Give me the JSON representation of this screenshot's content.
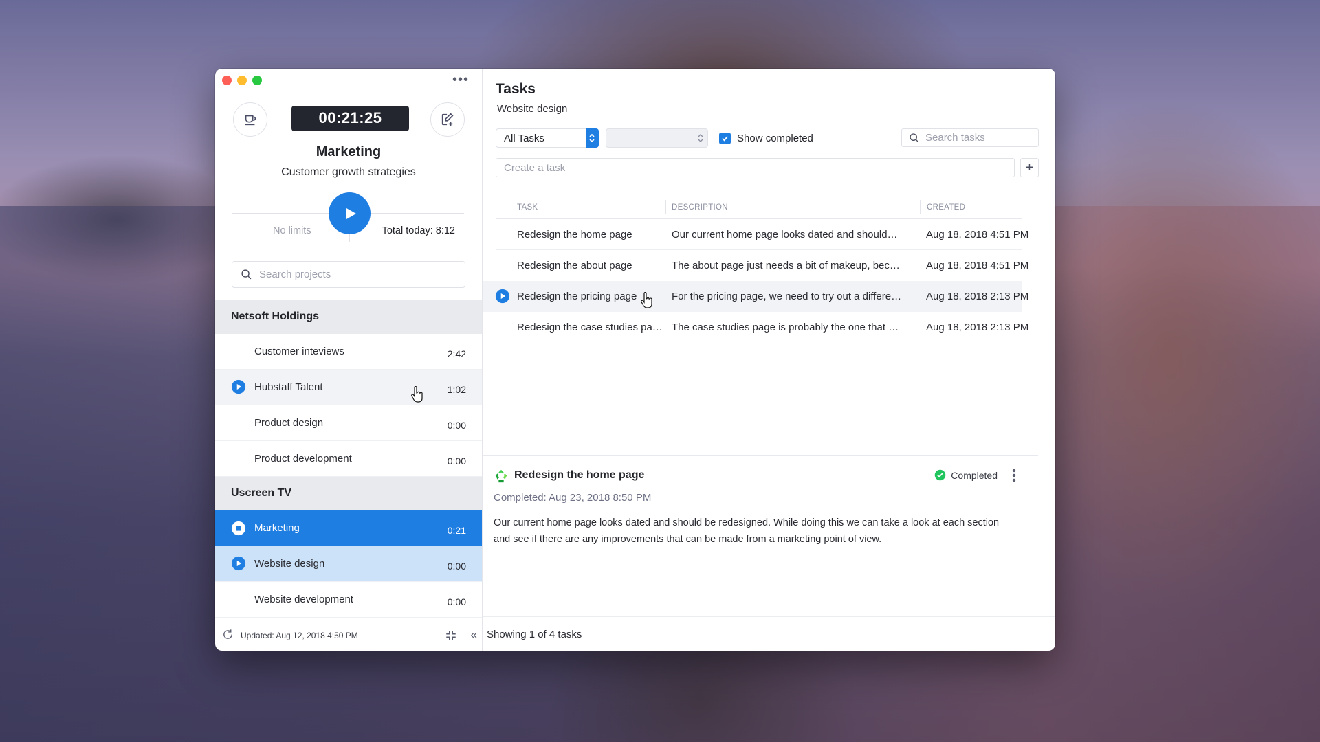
{
  "window": {
    "controls": [
      "close",
      "minimize",
      "zoom"
    ],
    "more_menu_icon": "ellipsis-icon"
  },
  "sidebar": {
    "break_button_icon": "coffee-cup-icon",
    "timer": "00:21:25",
    "edit_button_icon": "edit-add-icon",
    "current_project": "Marketing",
    "current_task": "Customer growth strategies",
    "limit_label": "No limits",
    "total_today": "Total today: 8:12",
    "search_placeholder": "Search projects",
    "groups": [
      {
        "name": "Netsoft Holdings",
        "projects": [
          {
            "name": "Customer inteviews",
            "time": "2:42",
            "state": "normal"
          },
          {
            "name": "Hubstaff Talent",
            "time": "1:02",
            "state": "hover"
          },
          {
            "name": "Product design",
            "time": "0:00",
            "state": "normal"
          },
          {
            "name": "Product development",
            "time": "0:00",
            "state": "normal"
          }
        ]
      },
      {
        "name": "Uscreen TV",
        "projects": [
          {
            "name": "Marketing",
            "time": "0:21",
            "state": "active-tracking"
          },
          {
            "name": "Website design",
            "time": "0:00",
            "state": "selected"
          },
          {
            "name": "Website development",
            "time": "0:00",
            "state": "normal"
          }
        ]
      }
    ],
    "footer": {
      "updated": "Updated: Aug 12, 2018 4:50 PM"
    }
  },
  "main": {
    "title": "Tasks",
    "subtitle": "Website design",
    "filter_select": "All Tasks",
    "secondary_select": "",
    "show_completed_label": "Show completed",
    "show_completed_checked": true,
    "search_placeholder": "Search tasks",
    "create_placeholder": "Create a task",
    "add_button": "+",
    "table": {
      "columns": [
        "TASK",
        "DESCRIPTION",
        "CREATED"
      ],
      "rows": [
        {
          "task": "Redesign the home page",
          "description": "Our current home page looks dated and should…",
          "created": "Aug 18, 2018 4:51 PM"
        },
        {
          "task": "Redesign the about page",
          "description": "The about page just needs a bit of makeup, bec…",
          "created": "Aug 18, 2018 4:51 PM"
        },
        {
          "task": "Redesign the pricing page",
          "description": "For the pricing page, we need to try out a differe…",
          "created": "Aug 18, 2018 2:13 PM"
        },
        {
          "task": "Redesign the case studies pa…",
          "description": "The case studies page is probably the one that …",
          "created": "Aug 18, 2018 2:13 PM"
        }
      ]
    },
    "detail": {
      "title": "Redesign the home page",
      "status": "Completed",
      "completed_at": "Completed: Aug 23, 2018 8:50 PM",
      "description": "Our current home page looks dated and should be redesigned. While doing this we can take a look at each section and see if there are any improvements that can be made from a marketing point of view."
    },
    "footer": {
      "showing": "Showing 1 of 4 tasks"
    }
  },
  "colors": {
    "accent": "#1f7ee2",
    "selected_row": "#cce2f8",
    "timer_bg": "#24262f",
    "success": "#21c55d"
  }
}
